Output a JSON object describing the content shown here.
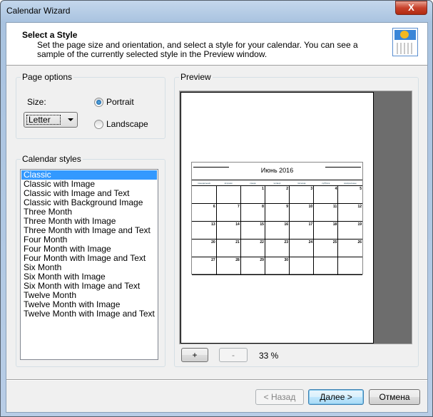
{
  "window": {
    "title": "Calendar Wizard",
    "close_glyph": "X"
  },
  "header": {
    "title": "Select a Style",
    "description": "Set the page size and orientation, and select a style for your calendar. You can see a sample of the currently selected style in the Preview window.",
    "icon": "calendar-image-icon"
  },
  "page_options": {
    "legend": "Page options",
    "size_label": "Size:",
    "size_value": "Letter",
    "orientation": [
      {
        "label": "Portrait",
        "checked": true
      },
      {
        "label": "Landscape",
        "checked": false
      }
    ]
  },
  "calendar_styles": {
    "legend": "Calendar styles",
    "selected": "Classic",
    "items": [
      "Classic",
      "Classic with Image",
      "Classic with Image and Text",
      "Classic with Background Image",
      "Three Month",
      "Three Month with Image",
      "Three Month with Image and Text",
      "Four Month",
      "Four Month with Image",
      "Four Month with Image and Text",
      "Six Month",
      "Six Month with Image",
      "Six Month with Image and Text",
      "Twelve Month",
      "Twelve Month with Image",
      "Twelve Month with Image and Text"
    ]
  },
  "preview": {
    "legend": "Preview",
    "zoom_in": "+",
    "zoom_out": "-",
    "zoom_level": "33 %",
    "calendar": {
      "month_title": "Июнь 2016",
      "weekdays": [
        "понедельник",
        "вторник",
        "среда",
        "четверг",
        "пятница",
        "суббота",
        "воскресенье"
      ],
      "weeks": [
        [
          "",
          "",
          "1",
          "2",
          "3",
          "4",
          "5"
        ],
        [
          "6",
          "7",
          "8",
          "9",
          "10",
          "11",
          "12"
        ],
        [
          "13",
          "14",
          "15",
          "16",
          "17",
          "18",
          "19"
        ],
        [
          "20",
          "21",
          "22",
          "23",
          "24",
          "25",
          "26"
        ],
        [
          "27",
          "28",
          "29",
          "30",
          "",
          "",
          ""
        ]
      ]
    }
  },
  "footer": {
    "back": "< Назад",
    "next": "Далее >",
    "cancel": "Отмена"
  }
}
